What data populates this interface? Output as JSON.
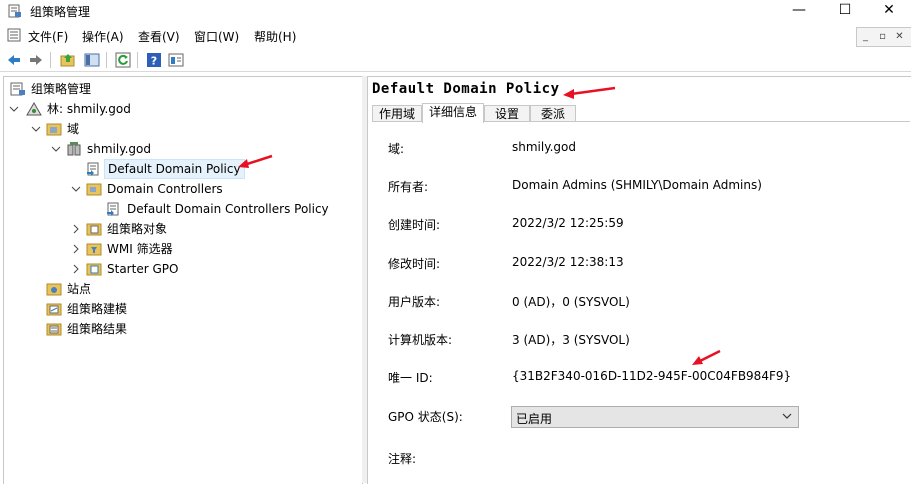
{
  "window": {
    "title": "组策略管理",
    "icon": "gpmc-app-icon",
    "controls": {
      "minimize": "—",
      "maximize": "☐",
      "close": "✕"
    }
  },
  "menubar": {
    "items": [
      {
        "label": "文件(F)"
      },
      {
        "label": "操作(A)"
      },
      {
        "label": "查看(V)"
      },
      {
        "label": "窗口(W)"
      },
      {
        "label": "帮助(H)"
      }
    ],
    "mdi_controls": {
      "minimize": "_",
      "restore": "▫",
      "close": "✕"
    }
  },
  "toolbar": {
    "buttons": [
      {
        "icon": "back-arrow-icon"
      },
      {
        "icon": "forward-arrow-icon"
      },
      {
        "icon": "up-folder-icon"
      },
      {
        "icon": "show-hide-tree-icon"
      },
      {
        "icon": "refresh-icon"
      },
      {
        "icon": "help-icon"
      },
      {
        "icon": "properties-icon"
      }
    ]
  },
  "tree": {
    "root": "组策略管理",
    "forest": "林: shmily.god",
    "domains": "域",
    "domain": "shmily.god",
    "default_policy": "Default Domain Policy",
    "domain_controllers": "Domain Controllers",
    "dc_policy": "Default Domain Controllers Policy",
    "gpo_objects": "组策略对象",
    "wmi_filters": "WMI 筛选器",
    "starter_gpo": "Starter GPO",
    "sites": "站点",
    "modeling": "组策略建模",
    "results": "组策略结果"
  },
  "details": {
    "policy_name": "Default Domain Policy",
    "tabs": [
      {
        "label": "作用域",
        "active": false
      },
      {
        "label": "详细信息",
        "active": true
      },
      {
        "label": "设置",
        "active": false
      },
      {
        "label": "委派",
        "active": false
      }
    ],
    "fields": {
      "domain": {
        "label": "域:",
        "value": "shmily.god"
      },
      "owner": {
        "label": "所有者:",
        "value": "Domain Admins (SHMILY\\Domain Admins)"
      },
      "created": {
        "label": "创建时间:",
        "value": "2022/3/2 12:25:59"
      },
      "modified": {
        "label": "修改时间:",
        "value": "2022/3/2 12:38:13"
      },
      "user_version": {
        "label": "用户版本:",
        "value": "0 (AD)，0 (SYSVOL)"
      },
      "computer_version": {
        "label": "计算机版本:",
        "value": "3 (AD)，3 (SYSVOL)"
      },
      "unique_id": {
        "label": "唯一 ID:",
        "value": "{31B2F340-016D-11D2-945F-00C04FB984F9}"
      },
      "gpo_status": {
        "label": "GPO 状态(S):",
        "value": "已启用"
      },
      "comment": {
        "label": "注释:",
        "value": ""
      }
    }
  },
  "colors": {
    "annotation_arrow": "#e81123",
    "selection": "#e5f1fb",
    "border": "#c8c8c8"
  }
}
